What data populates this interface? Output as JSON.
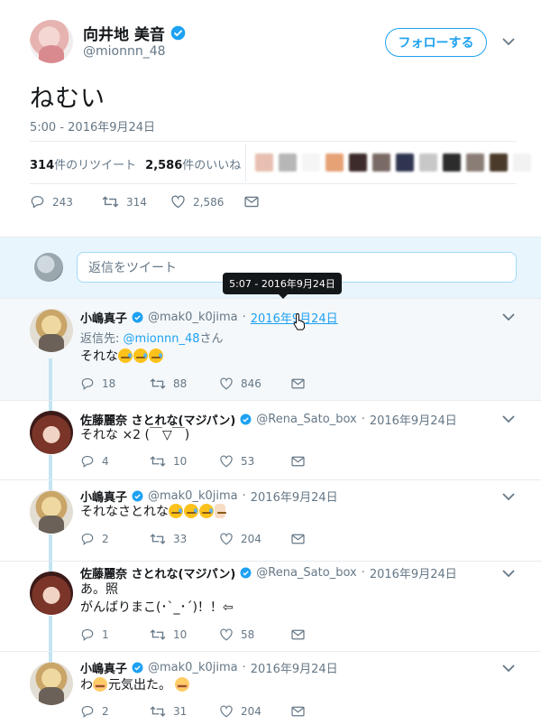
{
  "main_tweet": {
    "author_name": "向井地 美音",
    "author_handle": "@mionnn_48",
    "follow_label": "フォローする",
    "text": "ねむい",
    "timestamp": "5:00 - 2016年9月24日",
    "retweet_count": "314",
    "retweet_label": "件のリツイート",
    "like_count": "2,586",
    "like_label": "件のいいね",
    "reply_count": "243",
    "retweets": "314",
    "likes": "2,586",
    "liker_colors": [
      "#e8bfb0",
      "#b7b7b7",
      "#f5f5f5",
      "#e6a275",
      "#3d2a2a",
      "#7a6a66",
      "#2f3550",
      "#c8c8c8",
      "#2c2c2c",
      "#8a7d76",
      "#4a3a2a",
      "#f2f2f2"
    ]
  },
  "reply_box": {
    "placeholder": "返信をツイート"
  },
  "tooltip": {
    "text": "5:07 - 2016年9月24日"
  },
  "replies": [
    {
      "name": "小嶋真子",
      "handle": "@mak0_k0jima",
      "date": "2016年9月24日",
      "reply_to_prefix": "返信先:",
      "reply_to_handle": "@mionnn_48",
      "reply_to_suffix": "さん",
      "text": "それな",
      "replies": "18",
      "retweets": "88",
      "likes": "846"
    },
    {
      "name": "佐藤麗奈 さとれな(マジパン)",
      "handle": "@Rena_Sato_box",
      "date": "2016年9月24日",
      "text": "それな ×2 (￣▽￣)",
      "replies": "4",
      "retweets": "10",
      "likes": "53"
    },
    {
      "name": "小嶋真子",
      "handle": "@mak0_k0jima",
      "date": "2016年9月24日",
      "text": "それなさとれな",
      "replies": "2",
      "retweets": "33",
      "likes": "204"
    },
    {
      "name": "佐藤麗奈 さとれな(マジパン)",
      "handle": "@Rena_Sato_box",
      "date": "2016年9月24日",
      "text_line1": "あ。照",
      "text_line2": "がんばりまこ(･`_･´)！！⇦",
      "replies": "1",
      "retweets": "10",
      "likes": "58"
    },
    {
      "name": "小嶋真子",
      "handle": "@mak0_k0jima",
      "date": "2016年9月24日",
      "text_prefix": "わ",
      "text_suffix": "元気出た。",
      "replies": "2",
      "retweets": "31",
      "likes": "204"
    }
  ],
  "dot": "·",
  "colors": {
    "accent": "#1da1f2",
    "muted": "#657786",
    "highlight_bg": "#f5f8fa",
    "reply_box_bg": "#e8f5fd",
    "thread_line": "#c4e4f4"
  }
}
